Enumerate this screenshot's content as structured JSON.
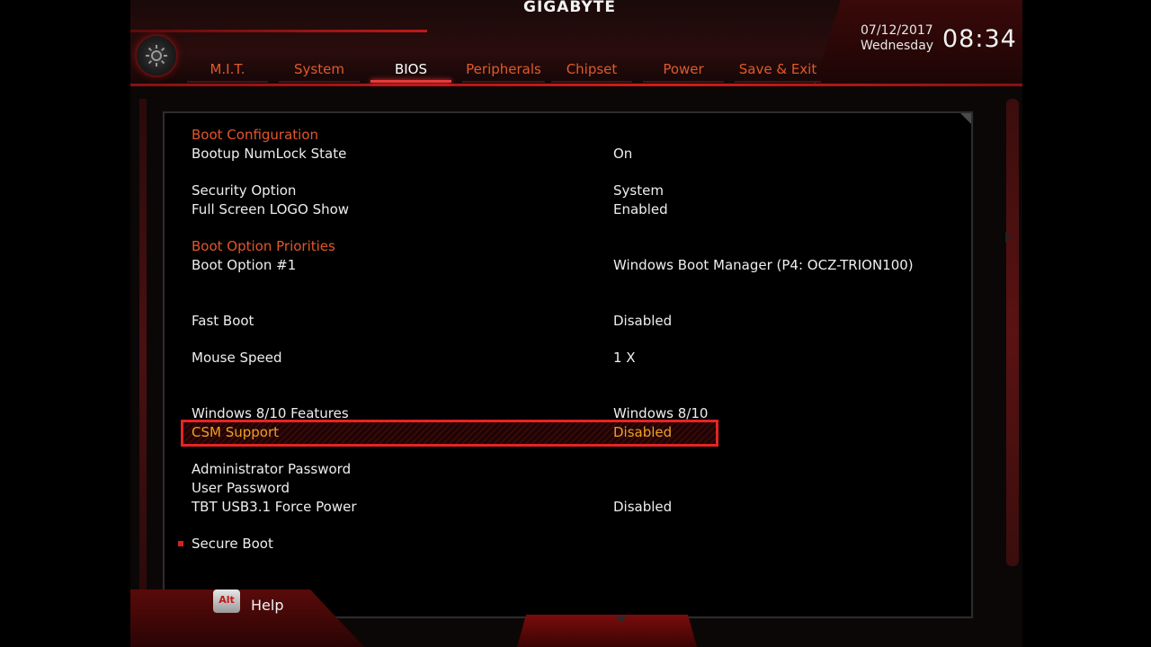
{
  "brand": "GIGABYTE",
  "datetime": {
    "date": "07/12/2017",
    "weekday": "Wednesday",
    "time": "08:34"
  },
  "tabs": [
    {
      "label": "M.I.T.",
      "active": false
    },
    {
      "label": "System",
      "active": false
    },
    {
      "label": "BIOS",
      "active": true
    },
    {
      "label": "Peripherals",
      "active": false
    },
    {
      "label": "Chipset",
      "active": false
    },
    {
      "label": "Power",
      "active": false
    },
    {
      "label": "Save & Exit",
      "active": false
    }
  ],
  "settings": [
    {
      "label": "Boot Configuration",
      "value": "",
      "type": "section"
    },
    {
      "label": "Bootup NumLock State",
      "value": "On"
    },
    {
      "label": "Security Option",
      "value": "System"
    },
    {
      "label": "Full Screen LOGO Show",
      "value": "Enabled"
    },
    {
      "label": "Boot Option Priorities",
      "value": "",
      "type": "section"
    },
    {
      "label": "Boot Option #1",
      "value": "Windows Boot Manager (P4: OCZ-TRION100)"
    },
    {
      "label": "Fast Boot",
      "value": "Disabled"
    },
    {
      "label": "Mouse Speed",
      "value": "1 X"
    },
    {
      "label": "Windows 8/10 Features",
      "value": "Windows 8/10"
    },
    {
      "label": "CSM Support",
      "value": "Disabled",
      "type": "highlight"
    },
    {
      "label": "Administrator Password",
      "value": ""
    },
    {
      "label": "User Password",
      "value": ""
    },
    {
      "label": "TBT USB3.1 Force Power",
      "value": "Disabled"
    },
    {
      "label": "Secure Boot",
      "value": ""
    }
  ],
  "footer": {
    "key": "Alt",
    "help_label": "Help"
  },
  "colors": {
    "accent": "#e42424",
    "section": "#e4562a",
    "highlight_text": "#f0a020"
  },
  "icons": {
    "settings": "gear-icon",
    "scroll_down": "down-arrow-icon",
    "scroll_right": "right-arrow-icon"
  }
}
